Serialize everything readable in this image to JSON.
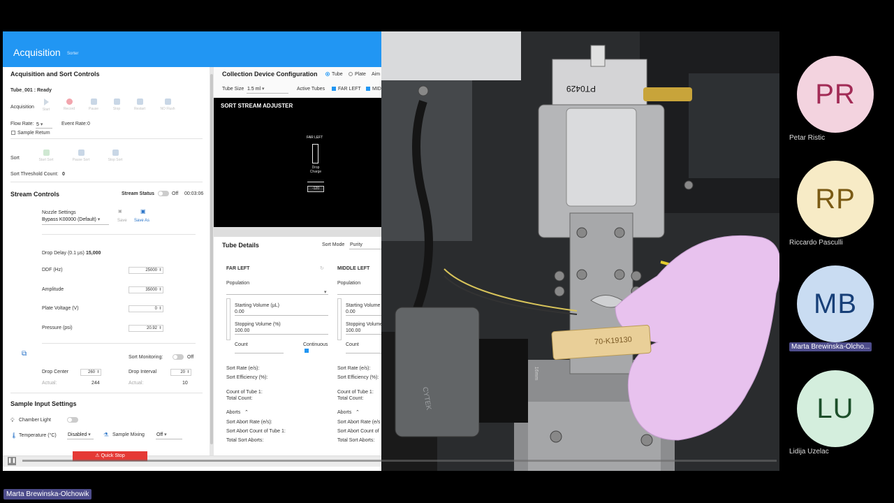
{
  "app": {
    "title": "Acquisition",
    "subtitle": "Sorter"
  },
  "acq": {
    "section_title": "Acquisition and Sort Controls",
    "tube_status": "Tube_001 : Ready",
    "acquisition_label": "Acquisition",
    "buttons": [
      "Start",
      "Record",
      "Pause",
      "Stop",
      "Restart",
      "NO Flush"
    ],
    "flow_rate_label": "Flow Rate:",
    "flow_rate_value": "5",
    "event_rate_label": "Event Rate:",
    "event_rate_value": "0",
    "sample_return": "Sample Return",
    "sort_label": "Sort",
    "sort_buttons": [
      "Start Sort",
      "Pause Sort",
      "Stop Sort"
    ],
    "sort_threshold_label": "Sort Threshold Count:",
    "sort_threshold_value": "0"
  },
  "stream": {
    "section_title": "Stream Controls",
    "status_label": "Stream Status",
    "status_value": "Off",
    "timer": "00:03:06",
    "nozzle_label": "Nozzle Settings",
    "nozzle_value": "Bypass K00000 (Default)",
    "save_label": "Save",
    "save_as_label": "Save As",
    "drop_delay_label": "Drop Delay (0.1 µs)",
    "drop_delay_value": "15,000",
    "ddf_label": "DDF (Hz)",
    "ddf_value": "25000",
    "amplitude_label": "Amplitude",
    "amplitude_value": "35000",
    "plate_voltage_label": "Plate Voltage (V)",
    "plate_voltage_value": "0",
    "pressure_label": "Pressure (psi)",
    "pressure_value": "20.92",
    "sort_monitoring_label": "Sort Monitoring:",
    "sort_monitoring_value": "Off",
    "drop_center_label": "Drop Center",
    "drop_center_value": "260",
    "drop_center_actual": "244",
    "drop_interval_label": "Drop Interval",
    "drop_interval_value": "20",
    "drop_interval_actual": "10",
    "actual_label": "Actual:"
  },
  "sample": {
    "section_title": "Sample Input Settings",
    "chamber_light": "Chamber Light",
    "temperature_label": "Temperature (°C)",
    "temperature_value": "Disabled",
    "mixing_label": "Sample Mixing",
    "mixing_value": "Off"
  },
  "quick_stop": "Quick Stop",
  "collection": {
    "section_title": "Collection Device Configuration",
    "tube_option": "Tube",
    "plate_option": "Plate",
    "aim_option": "Aim",
    "tube_size_label": "Tube Size",
    "tube_size_value": "1.5 ml",
    "active_tubes_label": "Active Tubes",
    "far_left": "FAR LEFT",
    "mid": "MID"
  },
  "adjuster": {
    "title": "SORT STREAM ADJUSTER",
    "far_left": "FAR LEFT",
    "drop_charge": "Drop Charge",
    "value": "-120"
  },
  "tube_details": {
    "section_title": "Tube Details",
    "sort_mode_label": "Sort Mode",
    "sort_mode_value": "Purity",
    "col1": "FAR LEFT",
    "col2": "MIDDLE LEFT",
    "population": "Population",
    "starting_volume": "Starting Volume (µL)",
    "starting_volume_value": "0.00",
    "stopping_volume": "Stopping Volume (%)",
    "stopping_volume_value": "100.00",
    "count": "Count",
    "continuous": "Continuous",
    "sort_rate": "Sort Rate (e/s):",
    "sort_efficiency": "Sort Efficiency (%):",
    "count_of_tube": "Count of Tube 1:",
    "total_count": "Total Count:",
    "aborts": "Aborts",
    "sort_abort_rate": "Sort Abort Rate (e/s):",
    "sort_abort_count": "Sort Abort Count of Tube 1:",
    "sort_abort_count_short": "Sort Abort Count of",
    "sort_abort_rate_short": "Sort Abort Rate (e/s",
    "total_sort_aborts": "Total Sort Aborts:"
  },
  "camera": {
    "label_pt": "PT0429",
    "label_70": "70-K19130",
    "brand": "CYTEK",
    "lens": "16mm"
  },
  "participants": [
    {
      "initials": "PR",
      "name": "Petar Ristic",
      "bg": "#f3d3df",
      "fg": "#a22b56"
    },
    {
      "initials": "RP",
      "name": "Riccardo Pasculli",
      "bg": "#f7ebc6",
      "fg": "#7a5a14"
    },
    {
      "initials": "MB",
      "name": "Marta Brewinska-Olcho...",
      "bg": "#c9dcf2",
      "fg": "#173f78"
    },
    {
      "initials": "LU",
      "name": "Lidija Uzelac",
      "bg": "#d4eedd",
      "fg": "#1c4f2a"
    }
  ],
  "speaker": "Marta Brewinska-Olchowik"
}
